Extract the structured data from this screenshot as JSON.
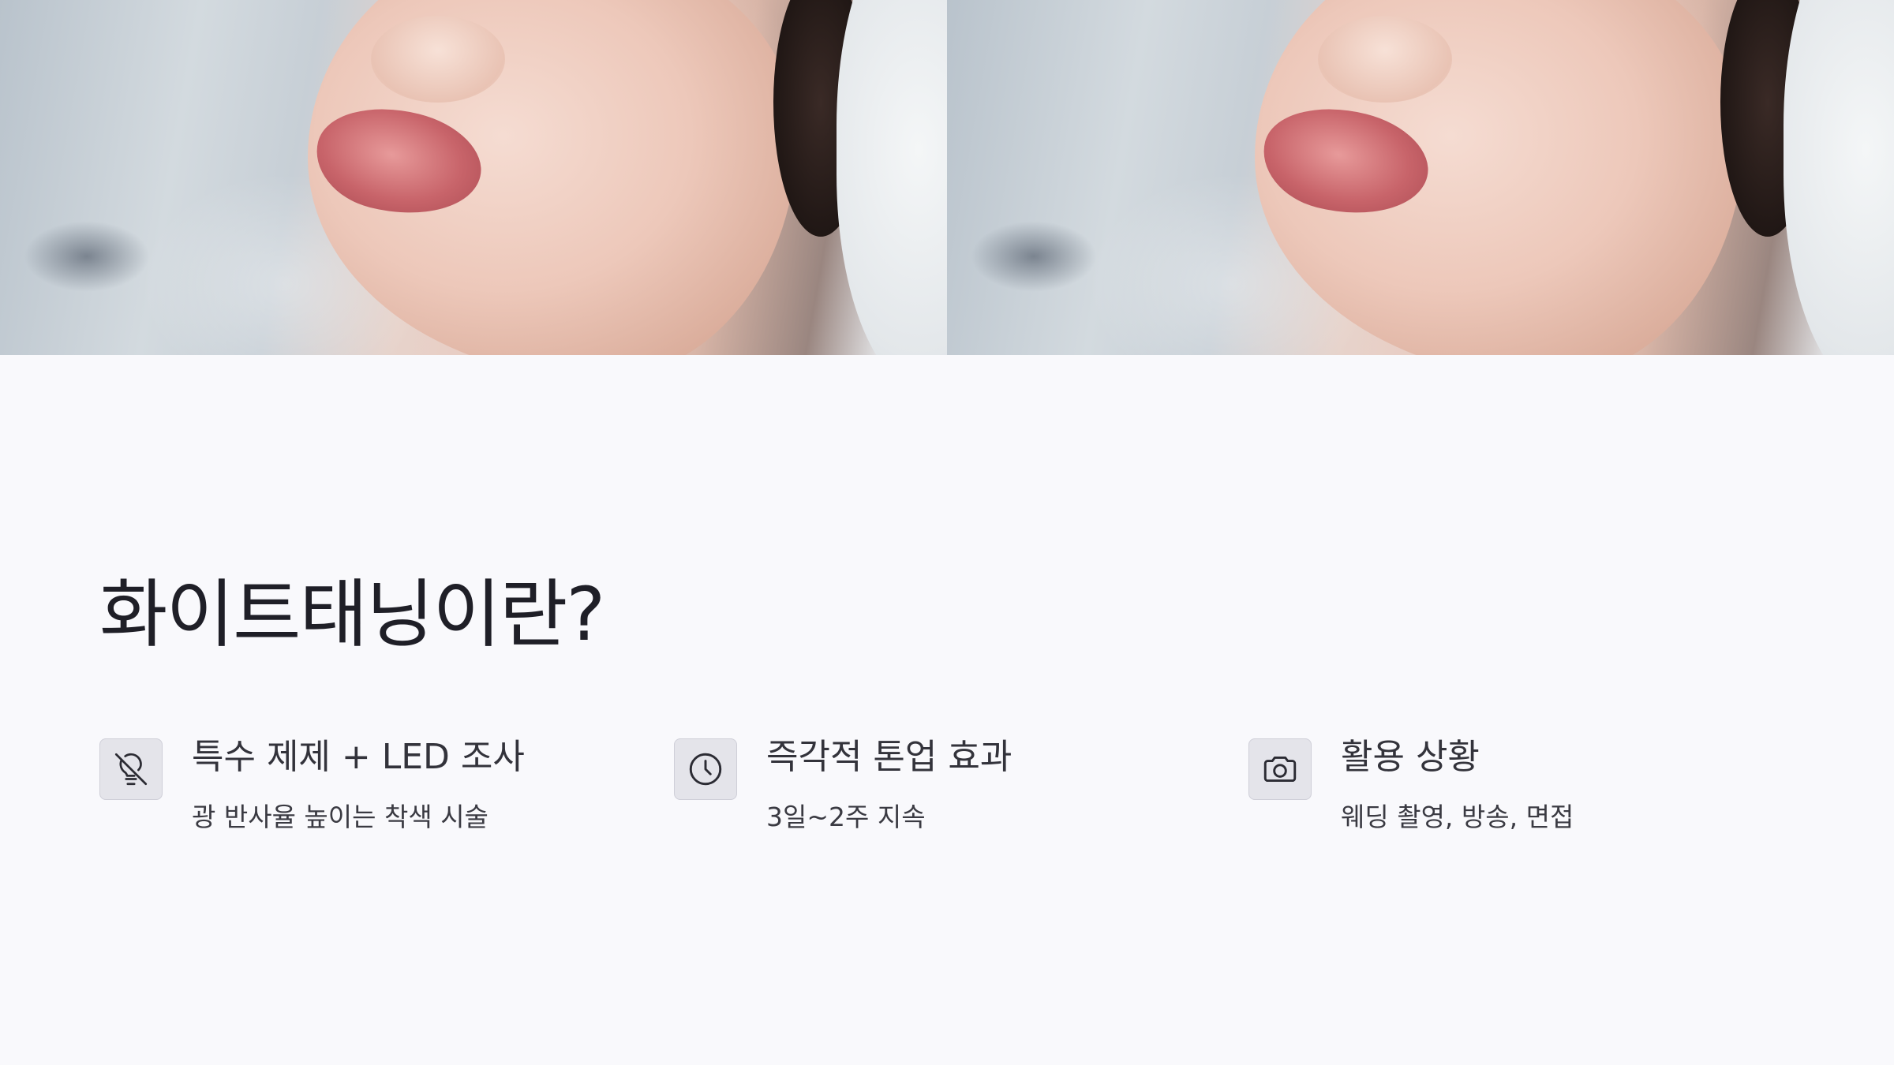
{
  "hero": {
    "images": [
      {
        "alt": "close-up face photo"
      },
      {
        "alt": "close-up face photo"
      }
    ]
  },
  "main": {
    "title": "화이트태닝이란?"
  },
  "features": [
    {
      "icon": "light-off-icon",
      "title": "특수 제제 + LED 조사",
      "desc": "광 반사율 높이는 착색 시술"
    },
    {
      "icon": "clock-icon",
      "title": "즉각적 톤업 효과",
      "desc": "3일~2주 지속"
    },
    {
      "icon": "camera-icon",
      "title": "활용 상황",
      "desc": "웨딩 촬영, 방송, 면접"
    }
  ],
  "colors": {
    "background": "#f9f9fc",
    "icon_box": "#e4e4ea",
    "title_text": "#1f1f27"
  }
}
